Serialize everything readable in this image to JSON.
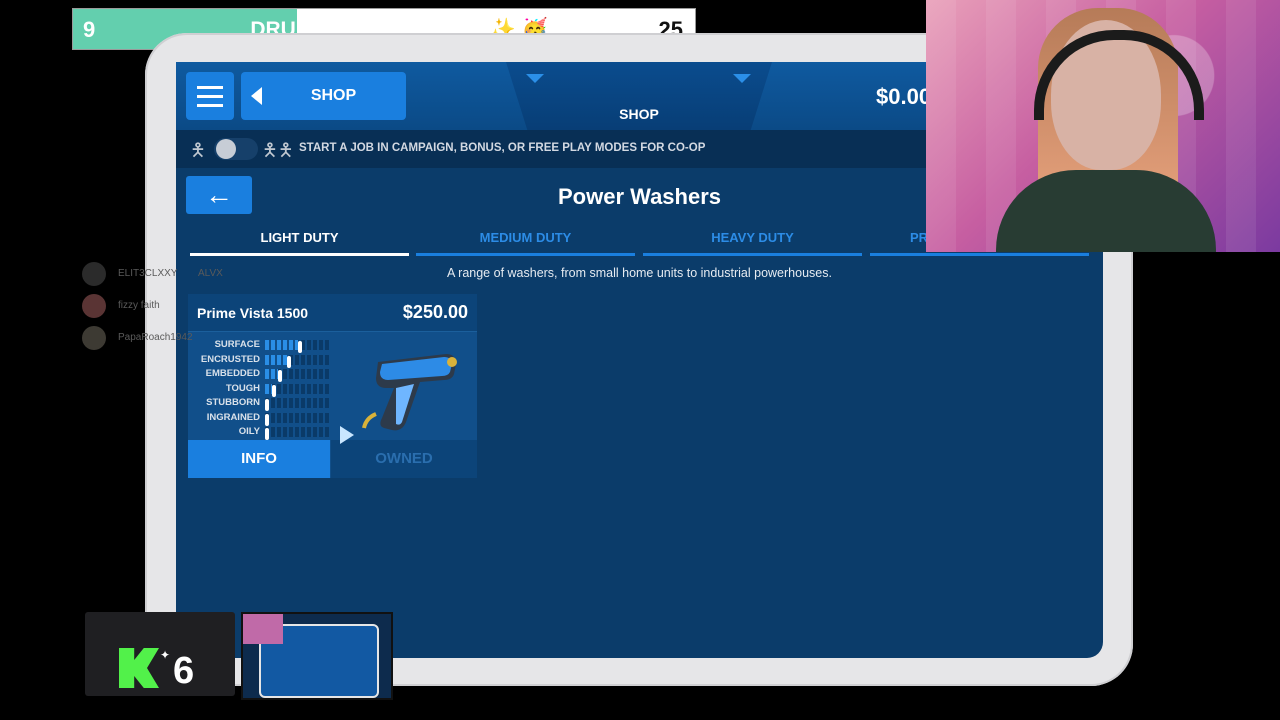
{
  "stream_bar": {
    "left_number": "9",
    "title": "DRUNK BDAY STREAM ✨ 🥳",
    "right_number": "25",
    "progress_fraction": 0.36,
    "accent_color": "#63cfae"
  },
  "game": {
    "header": {
      "back_label": "SHOP",
      "center_tab_label": "SHOP",
      "money": "$0.00"
    },
    "coop_bar": {
      "message": "START A JOB IN CAMPAIGN, BONUS, OR FREE PLAY MODES FOR CO-OP"
    },
    "page_title": "Power Washers",
    "back_arrow": "←",
    "tabs": [
      {
        "label": "LIGHT DUTY",
        "active": true
      },
      {
        "label": "MEDIUM DUTY",
        "active": false
      },
      {
        "label": "HEAVY DUTY",
        "active": false
      },
      {
        "label": "PR",
        "active": false
      }
    ],
    "description": "A range of washers, from small home units to industrial powerhouses.",
    "card": {
      "name": "Prime Vista 1500",
      "price": "$250.00",
      "stats": [
        {
          "label": "SURFACE",
          "level": 0.5
        },
        {
          "label": "ENCRUSTED",
          "level": 0.33
        },
        {
          "label": "EMBEDDED",
          "level": 0.2
        },
        {
          "label": "TOUGH",
          "level": 0.1
        },
        {
          "label": "STUBBORN",
          "level": 0.0
        },
        {
          "label": "INGRAINED",
          "level": 0.0
        },
        {
          "label": "OILY",
          "level": 0.0
        }
      ],
      "info_label": "INFO",
      "owned_label": "OWNED"
    }
  },
  "chat": [
    {
      "name": "ELIT3CLXXY",
      "badge": "ALVX"
    },
    {
      "name": "fizzy faith"
    },
    {
      "name": "PapaRoach1942"
    }
  ],
  "kick_widget": {
    "count": "6"
  }
}
